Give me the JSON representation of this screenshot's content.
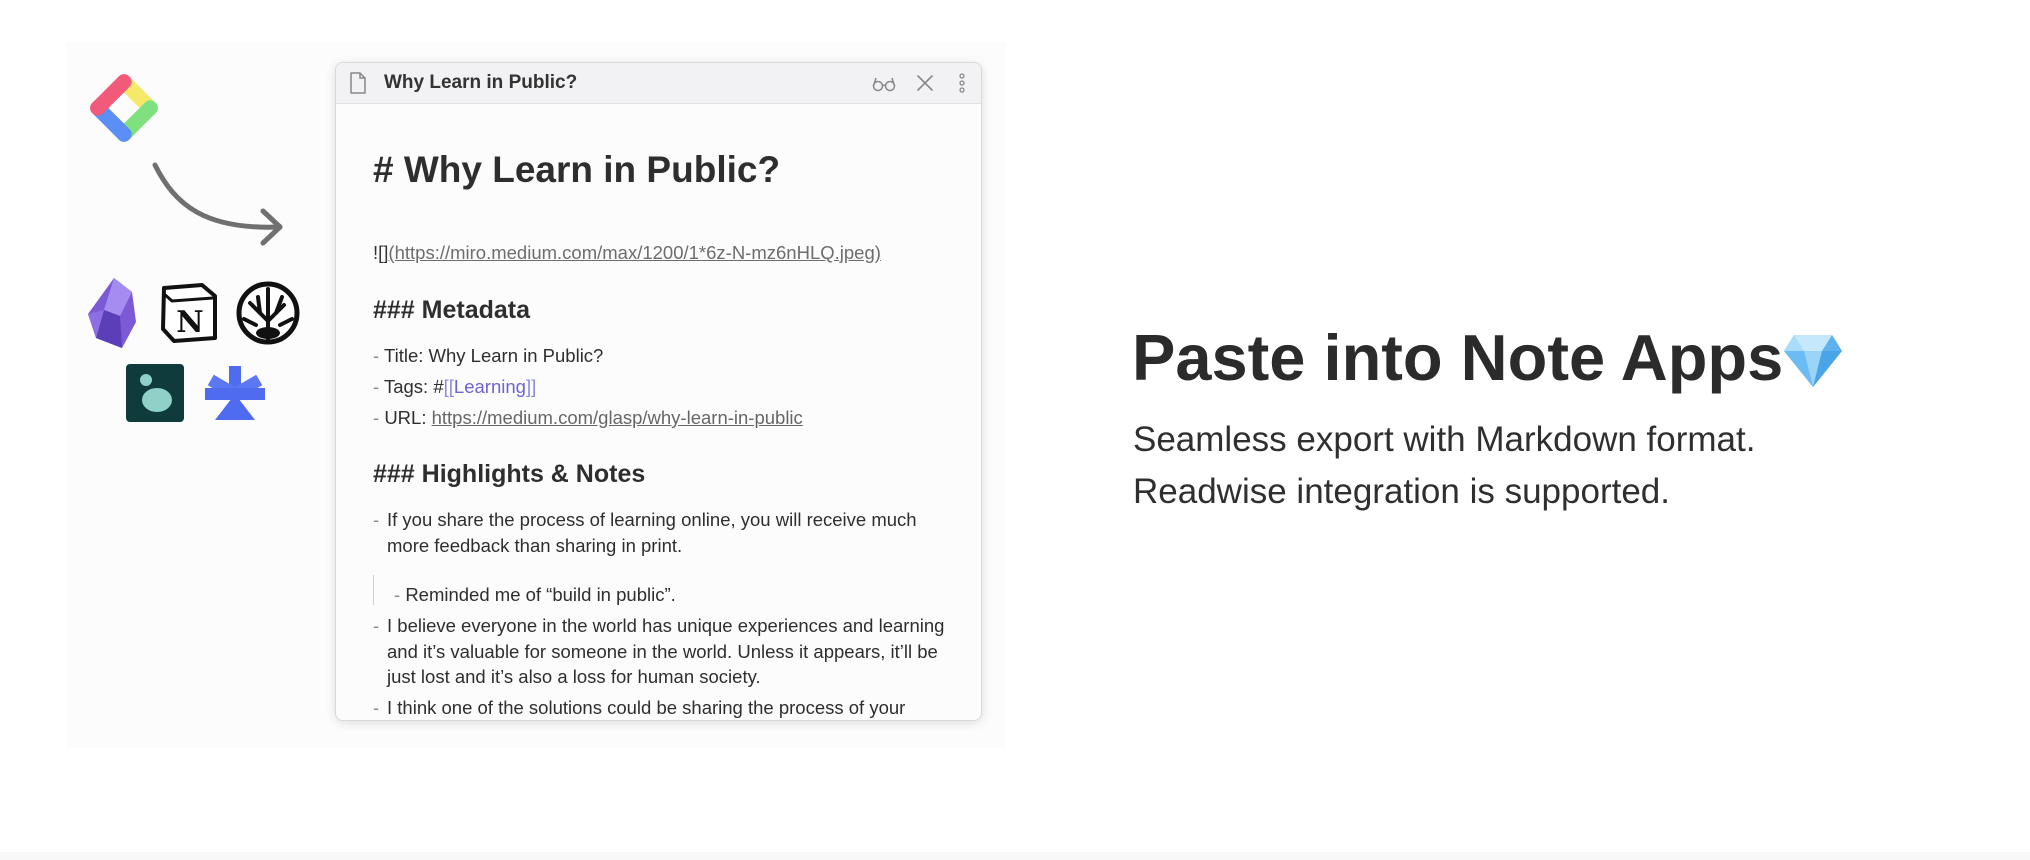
{
  "note": {
    "tab_title": "Why Learn in Public?",
    "h1": "# Why Learn in Public?",
    "image_prefix": "!",
    "image_brackets": "[]",
    "image_url": "(https://miro.medium.com/max/1200/1*6z-N-mz6nHLQ.jpeg)",
    "metadata_heading": "### Metadata",
    "title_line": "Title: Why Learn in Public?",
    "tags_prefix": "Tags: #",
    "tag_open": "[[",
    "tag": "Learning",
    "tag_close": "]]",
    "url_prefix": "URL: ",
    "url": "https://medium.com/glasp/why-learn-in-public",
    "highlights_heading": "### Highlights & Notes",
    "dash": "-",
    "highlights": [
      "If you share the process of learning online, you will receive much more feedback than sharing in print.",
      "I believe everyone in the world has unique experiences and learning and it’s valuable for someone in the world. Unless it appears, it’ll be just lost and it’s also a loss for human society.",
      "I think one of the solutions could be sharing the process of your learning passively."
    ],
    "sub_note": "Reminded me of “build in public”."
  },
  "hero": {
    "title": "Paste into Note Apps",
    "line1": "Seamless export with Markdown format.",
    "line2": "Readwise integration is supported."
  },
  "icons": [
    "glasp-logo-icon",
    "arrow-icon",
    "obsidian-icon",
    "notion-icon",
    "roam-research-icon",
    "craft-icon",
    "logseq-icon",
    "gem-icon",
    "file-icon",
    "glasses-icon",
    "close-icon",
    "more-vertical-icon"
  ],
  "colors": {
    "tag": "#6a65cf",
    "text": "#2e2e2e",
    "hero_text": "#2b2b2b"
  }
}
